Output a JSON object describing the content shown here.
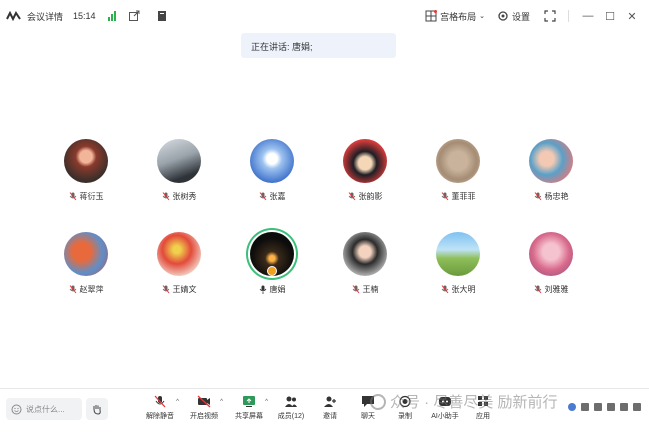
{
  "titlebar": {
    "app_title": "会议详情",
    "time": "15:14",
    "layout_label": "宫格布局",
    "settings_label": "设置"
  },
  "speaker": {
    "text": "正在讲话: 唐娟;"
  },
  "participants": [
    {
      "name": "蒋衍玉",
      "mic": "muted"
    },
    {
      "name": "张树秀",
      "mic": "muted"
    },
    {
      "name": "张嘉",
      "mic": "muted"
    },
    {
      "name": "张韵影",
      "mic": "muted"
    },
    {
      "name": "董菲菲",
      "mic": "muted"
    },
    {
      "name": "杨忠艳",
      "mic": "muted"
    },
    {
      "name": "赵翠萍",
      "mic": "muted"
    },
    {
      "name": "王婧文",
      "mic": "muted"
    },
    {
      "name": "唐娟",
      "mic": "on"
    },
    {
      "name": "王楠",
      "mic": "muted"
    },
    {
      "name": "张大明",
      "mic": "muted"
    },
    {
      "name": "刘雅雅",
      "mic": "muted"
    }
  ],
  "bottombar": {
    "chat_placeholder": "说点什么...",
    "tools": [
      {
        "label": "解除静音",
        "icon": "mic-muted-icon"
      },
      {
        "label": "开启视频",
        "icon": "video-off-icon"
      },
      {
        "label": "共享屏幕",
        "icon": "share-screen-icon"
      },
      {
        "label": "成员(12)",
        "icon": "members-icon"
      },
      {
        "label": "邀请",
        "icon": "invite-icon"
      },
      {
        "label": "聊天",
        "icon": "chat-icon"
      },
      {
        "label": "录制",
        "icon": "record-icon"
      },
      {
        "label": "AI小助手",
        "icon": "ai-assistant-icon"
      },
      {
        "label": "应用",
        "icon": "apps-icon"
      }
    ]
  },
  "watermark": {
    "text": "众号 · 尽善尽美 励新前行"
  },
  "colors": {
    "signal": "#2cb24a",
    "active_ring": "#3bbf7a",
    "speaker_bg": "#eef3fb"
  }
}
